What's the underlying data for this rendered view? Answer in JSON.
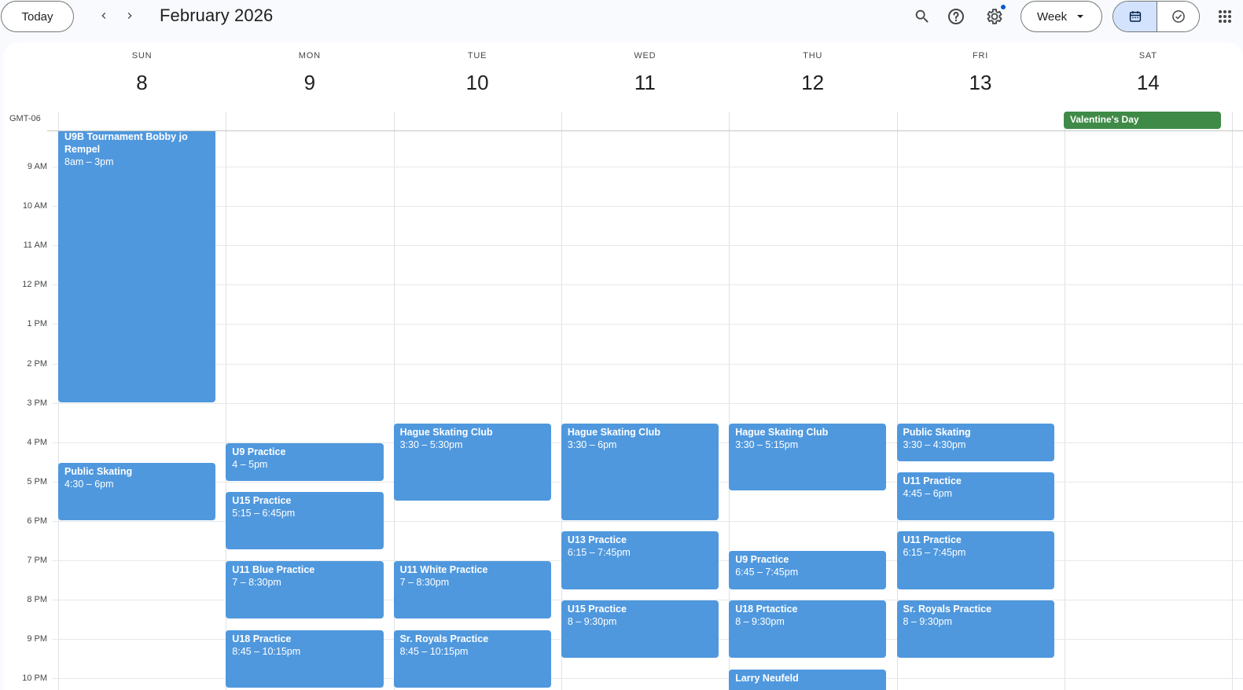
{
  "header": {
    "today_label": "Today",
    "prev_icon": "chevron-left-icon",
    "next_icon": "chevron-right-icon",
    "month_title": "February 2026",
    "search_icon": "search-icon",
    "help_icon": "help-icon",
    "settings_icon": "gear-icon",
    "view_label": "Week",
    "calendar_icon": "calendar-icon",
    "tasks_icon": "task-check-icon",
    "apps_icon": "apps-grid-icon"
  },
  "timezone": "GMT-06",
  "days": [
    {
      "dow": "SUN",
      "num": "8"
    },
    {
      "dow": "MON",
      "num": "9"
    },
    {
      "dow": "TUE",
      "num": "10"
    },
    {
      "dow": "WED",
      "num": "11"
    },
    {
      "dow": "THU",
      "num": "12"
    },
    {
      "dow": "FRI",
      "num": "13"
    },
    {
      "dow": "SAT",
      "num": "14"
    }
  ],
  "times": [
    "9 AM",
    "10 AM",
    "11 AM",
    "12 PM",
    "1 PM",
    "2 PM",
    "3 PM",
    "4 PM",
    "5 PM",
    "6 PM",
    "7 PM",
    "8 PM",
    "9 PM",
    "10 PM"
  ],
  "allday": {
    "title": "Valentine's Day"
  },
  "events": [
    {
      "day": 0,
      "title": "U9B Tournament Bobby jo Rempel",
      "time": "8am – 3pm",
      "start": 8.0,
      "end": 15.0
    },
    {
      "day": 0,
      "title": "Public Skating",
      "time": "4:30 – 6pm",
      "start": 16.5,
      "end": 18.0
    },
    {
      "day": 1,
      "title": "U9 Practice",
      "time": "4 – 5pm",
      "start": 16.0,
      "end": 17.0
    },
    {
      "day": 1,
      "title": "U15 Practice",
      "time": "5:15 – 6:45pm",
      "start": 17.25,
      "end": 18.75
    },
    {
      "day": 1,
      "title": "U11 Blue Practice",
      "time": "7 – 8:30pm",
      "start": 19.0,
      "end": 20.5
    },
    {
      "day": 1,
      "title": "U18 Practice",
      "time": "8:45 – 10:15pm",
      "start": 20.75,
      "end": 22.25
    },
    {
      "day": 2,
      "title": "Hague Skating Club",
      "time": "3:30 – 5:30pm",
      "start": 15.5,
      "end": 17.5
    },
    {
      "day": 2,
      "title": "U11 White Practice",
      "time": "7 – 8:30pm",
      "start": 19.0,
      "end": 20.5
    },
    {
      "day": 2,
      "title": "Sr. Royals Practice",
      "time": "8:45 – 10:15pm",
      "start": 20.75,
      "end": 22.25
    },
    {
      "day": 3,
      "title": "Hague Skating Club",
      "time": "3:30 – 6pm",
      "start": 15.5,
      "end": 18.0
    },
    {
      "day": 3,
      "title": "U13 Practice",
      "time": "6:15 – 7:45pm",
      "start": 18.25,
      "end": 19.75
    },
    {
      "day": 3,
      "title": "U15 Practice",
      "time": "8 – 9:30pm",
      "start": 20.0,
      "end": 21.5
    },
    {
      "day": 4,
      "title": "Hague Skating Club",
      "time": "3:30 – 5:15pm",
      "start": 15.5,
      "end": 17.25
    },
    {
      "day": 4,
      "title": "U9 Practice",
      "time": "6:45 – 7:45pm",
      "start": 18.75,
      "end": 19.75
    },
    {
      "day": 4,
      "title": "U18 Prtactice",
      "time": "8 – 9:30pm",
      "start": 20.0,
      "end": 21.5
    },
    {
      "day": 4,
      "title": "Larry Neufeld",
      "time": "",
      "start": 21.75,
      "end": 23.0
    },
    {
      "day": 5,
      "title": "Public Skating",
      "time": "3:30 – 4:30pm",
      "start": 15.5,
      "end": 16.5
    },
    {
      "day": 5,
      "title": "U11 Practice",
      "time": "4:45 – 6pm",
      "start": 16.75,
      "end": 18.0
    },
    {
      "day": 5,
      "title": "U11 Practice",
      "time": "6:15 – 7:45pm",
      "start": 18.25,
      "end": 19.75
    },
    {
      "day": 5,
      "title": "Sr. Royals Practice",
      "time": "8 – 9:30pm",
      "start": 20.0,
      "end": 21.5
    }
  ]
}
